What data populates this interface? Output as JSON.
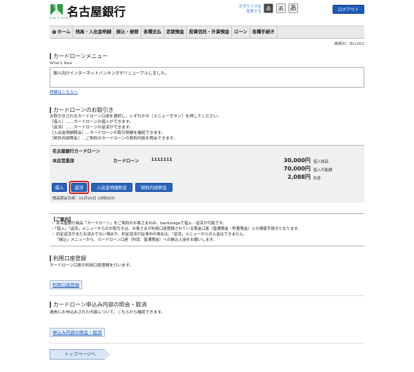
{
  "header": {
    "bank_name": "名古屋銀行",
    "logo_sub": "BANK OF NAGOYA",
    "font_size_label_1": "文字サイズを",
    "font_size_label_2": "変更する",
    "font_small": "あ",
    "font_mid": "あ",
    "font_large": "あ",
    "logout": "ログアウト"
  },
  "nav": {
    "items": [
      "ホーム",
      "残高・入出金明細",
      "振込・振替",
      "各種支払",
      "定期預金",
      "投資信託・外貨預金",
      "ローン",
      "各種手続き"
    ]
  },
  "screen_id": "画面ID：BCL001",
  "menu_title": "カードローンメニュー",
  "whats_new": {
    "label": "What's New",
    "message": "個人向けインターネットバンキングがリニューアルしました。",
    "detail_link": "詳細はこちらへ"
  },
  "transactions": {
    "title": "カードローンのお取引き",
    "lines": [
      "お取引きされるカードローン口座を選択し、いずれかの［メニューボタン］を押してください。",
      "［借入］……カードローンの借入ができます。",
      "［返済］……カードローンの返済ができます。",
      "［入出金明細照会］…カードローンの取引明細を確認できます。",
      "［契約内容照会］…ご契約のカードローンの契約内容を照会できます。"
    ]
  },
  "loan": {
    "name": "名古屋銀行カードローン",
    "branch": "本店営業部",
    "kind": "カードローン",
    "account_no": "1111111",
    "balance": "30,000円",
    "balance_label": "借入残高",
    "available": "70,000円",
    "available_label": "借入可能額",
    "interest": "2,088円",
    "interest_label": "利息",
    "buttons": {
      "borrow": "借入",
      "repay": "返済",
      "history": "入出金明細照会",
      "contract": "契約内容照会"
    },
    "as_of": "残高照会日時：01月20日 10時00分"
  },
  "notice": {
    "title": "【ご案内】",
    "lines": [
      "・ 名古屋銀行商品「カードローン」をご契約のお客さまのみ、bankstageで借入・返済が可能です。",
      "・「借入」「返済」メニューからのお取引きは、お客さまが利用口座登録されている預金口座（普通預金・貯蓄預金）との振替手続きとなります。",
      "・ 約定返済がまだお済みでない場合や、約定返済が延滞中の場合は、「返済」メニューからの入金はできません。",
      "「振込」メニューから、カードローン口座（科目：普通預金）への振込入金をお願いします。"
    ]
  },
  "account_registration": {
    "title": "利用口座登録",
    "desc": "カードローン口座の利用口座登録を行います。",
    "button": "利用口座登録"
  },
  "application": {
    "title": "カードローン申込み内容の照会・取消",
    "desc": "過去にお申込みされた内容について、こちらから確認できます。",
    "button": "申込み内容の照会・取消"
  },
  "top_page": "トップページへ"
}
